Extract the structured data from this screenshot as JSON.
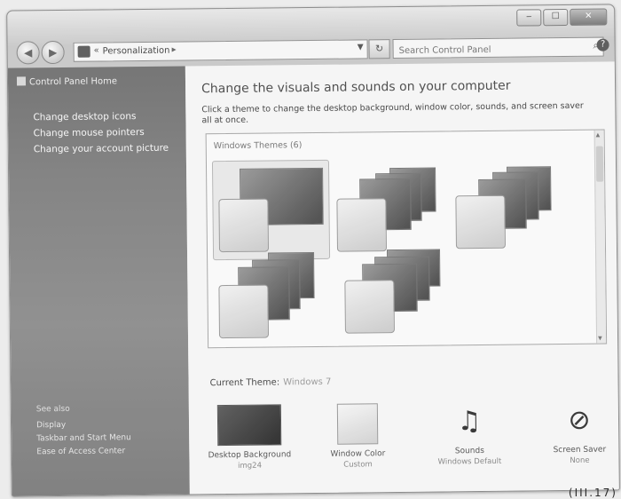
{
  "window": {
    "title": "",
    "caption": {
      "minimize": "‒",
      "maximize": "☐",
      "close": "✕"
    }
  },
  "nav": {
    "back": "◀",
    "forward": "▶",
    "breadcrumb_sep": "«",
    "breadcrumb": "Personalization",
    "breadcrumb_arrow": "▸",
    "refresh": "↻",
    "search_placeholder": "Search Control Panel",
    "search_icon": "⌕",
    "help": "?"
  },
  "sidebar": {
    "home": "Control Panel Home",
    "links": [
      "Change desktop icons",
      "Change mouse pointers",
      "Change your account picture"
    ],
    "see_also": "See also",
    "see_also_links": [
      "Display",
      "Taskbar and Start Menu",
      "Ease of Access Center"
    ]
  },
  "main": {
    "heading": "Change the visuals and sounds on your computer",
    "description": "Click a theme to change the desktop background, window color, sounds, and screen saver all at once.",
    "themes_group": "Windows Themes (6)",
    "current_label": "Current Theme:",
    "current_value": "Windows 7"
  },
  "bottom": [
    {
      "label": "Desktop Background",
      "sub": "img24"
    },
    {
      "label": "Window Color",
      "sub": "Custom"
    },
    {
      "label": "Sounds",
      "sub": "Windows Default"
    },
    {
      "label": "Screen Saver",
      "sub": "None"
    }
  ],
  "icons": {
    "sounds": "♫",
    "screen_saver": "⊘"
  },
  "figure_number": "(III.17)"
}
